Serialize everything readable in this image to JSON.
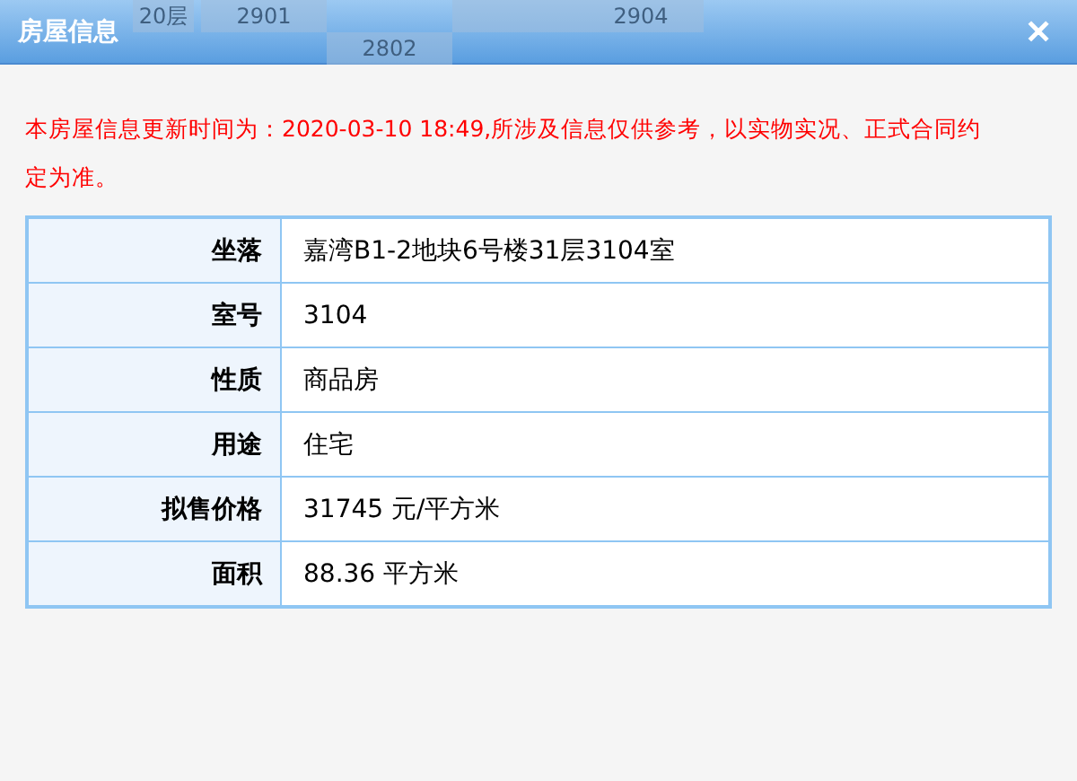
{
  "background_tiles": [
    {
      "label": "20层",
      "kind": "floor"
    },
    {
      "label": "2901",
      "kind": "upper"
    },
    {
      "label": "2802",
      "kind": "lower"
    },
    {
      "kind": "upper"
    },
    {
      "label": "2904",
      "kind": "upper"
    }
  ],
  "window": {
    "title": "房屋信息",
    "close": "✕"
  },
  "notice": "本房屋信息更新时间为：2020-03-10 18:49,所涉及信息仅供参考，以实物实况、正式合同约定为准。",
  "rows": [
    {
      "label": "坐落",
      "value": "嘉湾B1-2地块6号楼31层3104室"
    },
    {
      "label": "室号",
      "value": "3104"
    },
    {
      "label": "性质",
      "value": "商品房"
    },
    {
      "label": "用途",
      "value": "住宅"
    },
    {
      "label": "拟售价格",
      "value": "31745 元/平方米"
    },
    {
      "label": "面积",
      "value": "88.36 平方米"
    }
  ]
}
